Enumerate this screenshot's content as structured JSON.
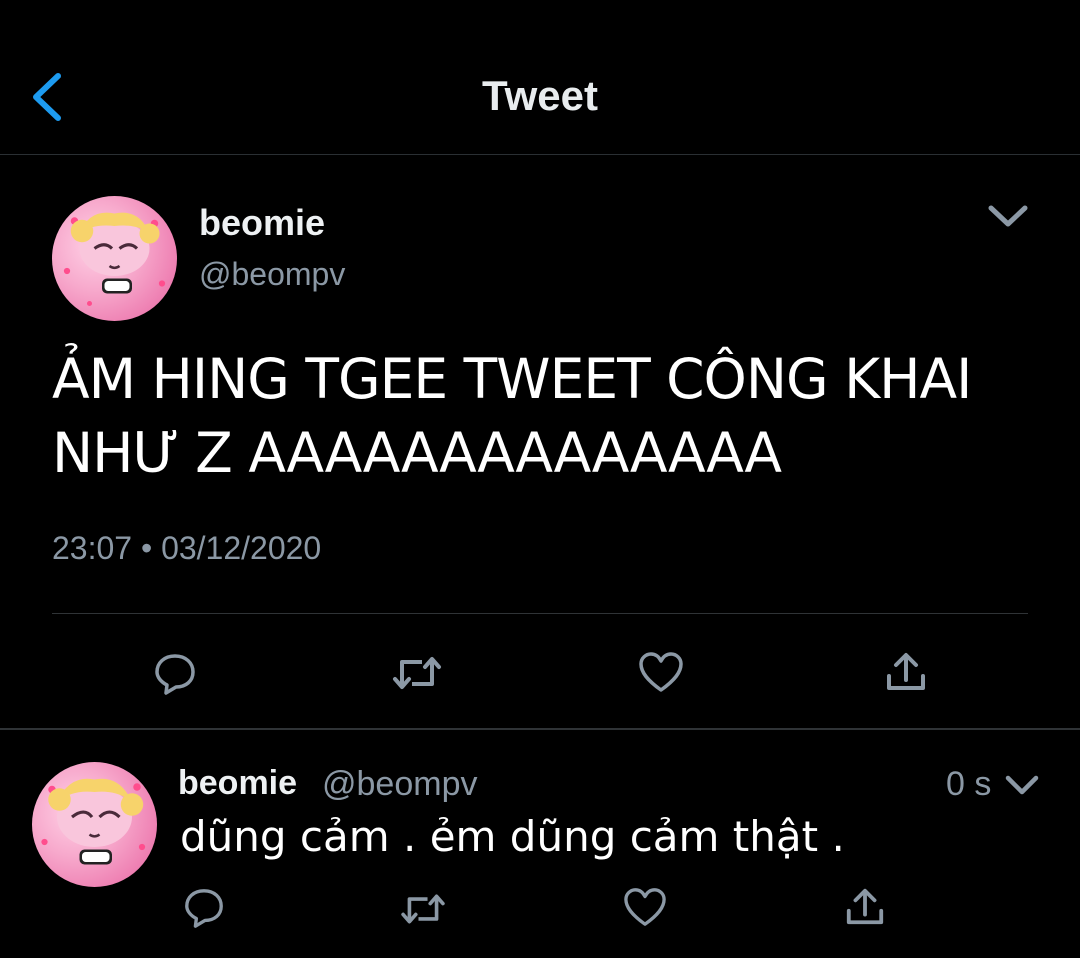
{
  "header": {
    "title": "Tweet",
    "back_icon": "chevron-left-icon",
    "accent": "#1d9bf0"
  },
  "tweet": {
    "name": "beomie",
    "handle": "@beompv",
    "text_line1": "ẢM HING TGEE TWEET CÔNG KHAI",
    "text_line2": "NHƯ Z AAAAAAAAAAAAAA",
    "meta": "23:07 • 03/12/2020",
    "menu_icon": "chevron-down-icon",
    "actions": [
      "reply-icon",
      "retweet-icon",
      "like-icon",
      "share-icon"
    ]
  },
  "reply": {
    "name": "beomie",
    "handle": "@beompv",
    "time": "0 s",
    "text": "dũng cảm . ẻm dũng cảm thật .",
    "actions": [
      "reply-icon",
      "retweet-icon",
      "like-icon",
      "share-icon"
    ]
  },
  "colors": {
    "background": "#000000",
    "secondary_text": "#8b98a5",
    "divider": "#2f3336"
  }
}
